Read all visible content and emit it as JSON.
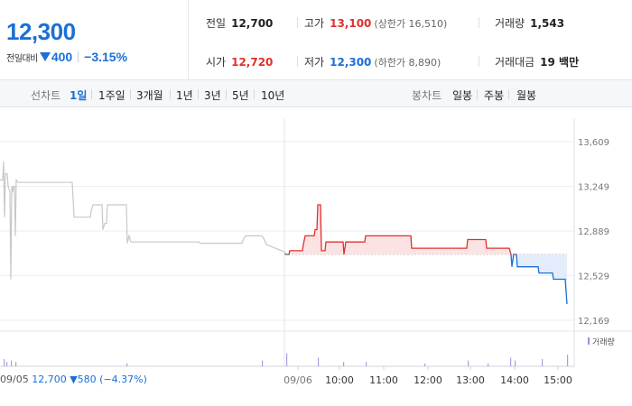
{
  "header": {
    "current_price": "12,300",
    "change_label": "전일대비",
    "change_abs": "400",
    "change_pct": "−3.15%",
    "stats": {
      "prev_close": {
        "label": "전일",
        "value": "12,700"
      },
      "high": {
        "label": "고가",
        "value": "13,100",
        "sub": "(상한가 16,510)"
      },
      "volume": {
        "label": "거래량",
        "value": "1,543"
      },
      "open": {
        "label": "시가",
        "value": "12,720"
      },
      "low": {
        "label": "저가",
        "value": "12,300",
        "sub": "(하한가 8,890)"
      },
      "amount": {
        "label": "거래대금",
        "value": "19 백만"
      }
    }
  },
  "tabs": {
    "line_label": "선차트",
    "periods": [
      "1일",
      "1주일",
      "3개월",
      "1년",
      "3년",
      "5년",
      "10년"
    ],
    "candle_label": "봉차트",
    "candles": [
      "일봉",
      "주봉",
      "월봉"
    ]
  },
  "chart_data": {
    "type": "line",
    "y_ticks": [
      "13,609",
      "13,249",
      "12,889",
      "12,529",
      "12,169"
    ],
    "x_ticks": [
      "09/06",
      "10:00",
      "11:00",
      "12:00",
      "13:00",
      "14:00",
      "15:00"
    ],
    "x_start_label": "09/05",
    "volume_label": "거래량",
    "reference_price": 12700,
    "prev_day_summary": {
      "price": "12,700",
      "change": "580",
      "pct": "(−4.37%)"
    },
    "colors": {
      "up": "#e0302c",
      "down": "#1b6fd8",
      "prev": "#c8c8c8",
      "up_fill": "#fbe3e3",
      "down_fill": "#e3ecfa"
    },
    "prev_day_series": [
      [
        0,
        13300
      ],
      [
        3,
        13300
      ],
      [
        4,
        13450
      ],
      [
        5,
        13000
      ],
      [
        6,
        13350
      ],
      [
        8,
        13350
      ],
      [
        9,
        13250
      ],
      [
        11,
        13200
      ],
      [
        12,
        12500
      ],
      [
        13,
        13250
      ],
      [
        14,
        13200
      ],
      [
        15,
        13250
      ],
      [
        16,
        13250
      ],
      [
        17,
        12850
      ],
      [
        18,
        13300
      ],
      [
        20,
        13280
      ],
      [
        80,
        13280
      ],
      [
        81,
        13150
      ],
      [
        82,
        13000
      ],
      [
        100,
        13000
      ],
      [
        101,
        13050
      ],
      [
        103,
        13100
      ],
      [
        113,
        13100
      ],
      [
        114,
        12900
      ],
      [
        116,
        12950
      ],
      [
        118,
        12950
      ],
      [
        119,
        13100
      ],
      [
        140,
        13100
      ],
      [
        141,
        12790
      ],
      [
        143,
        12850
      ],
      [
        145,
        12800
      ],
      [
        200,
        12800
      ],
      [
        220,
        12800
      ],
      [
        222,
        12790
      ],
      [
        268,
        12790
      ],
      [
        270,
        12830
      ],
      [
        272,
        12850
      ],
      [
        290,
        12850
      ],
      [
        292,
        12830
      ],
      [
        295,
        12780
      ],
      [
        305,
        12750
      ],
      [
        315,
        12720
      ]
    ],
    "today_series": [
      [
        315,
        12720
      ],
      [
        316,
        12700
      ],
      [
        320,
        12700
      ],
      [
        321,
        12730
      ],
      [
        335,
        12730
      ],
      [
        336,
        12780
      ],
      [
        338,
        12850
      ],
      [
        348,
        12850
      ],
      [
        349,
        12900
      ],
      [
        351,
        12900
      ],
      [
        352,
        13100
      ],
      [
        355,
        13100
      ],
      [
        356,
        12730
      ],
      [
        358,
        12730
      ],
      [
        360,
        12730
      ],
      [
        361,
        12800
      ],
      [
        380,
        12800
      ],
      [
        381,
        12700
      ],
      [
        383,
        12800
      ],
      [
        404,
        12800
      ],
      [
        405,
        12850
      ],
      [
        455,
        12850
      ],
      [
        456,
        12750
      ],
      [
        517,
        12750
      ],
      [
        518,
        12820
      ],
      [
        538,
        12820
      ],
      [
        539,
        12750
      ],
      [
        564,
        12750
      ],
      [
        566,
        12700
      ],
      [
        567,
        12600
      ],
      [
        569,
        12700
      ],
      [
        572,
        12700
      ],
      [
        573,
        12600
      ],
      [
        596,
        12600
      ],
      [
        597,
        12550
      ],
      [
        612,
        12550
      ],
      [
        613,
        12500
      ],
      [
        626,
        12500
      ],
      [
        628,
        12300
      ]
    ],
    "volume_bars": [
      [
        4,
        5
      ],
      [
        7,
        3
      ],
      [
        12,
        4
      ],
      [
        17,
        3
      ],
      [
        140,
        2
      ],
      [
        290,
        4
      ],
      [
        317,
        9
      ],
      [
        352,
        6
      ],
      [
        380,
        3
      ],
      [
        405,
        3
      ],
      [
        470,
        2
      ],
      [
        518,
        4
      ],
      [
        540,
        2
      ],
      [
        565,
        6
      ],
      [
        570,
        4
      ],
      [
        600,
        5
      ],
      [
        628,
        8
      ]
    ]
  }
}
